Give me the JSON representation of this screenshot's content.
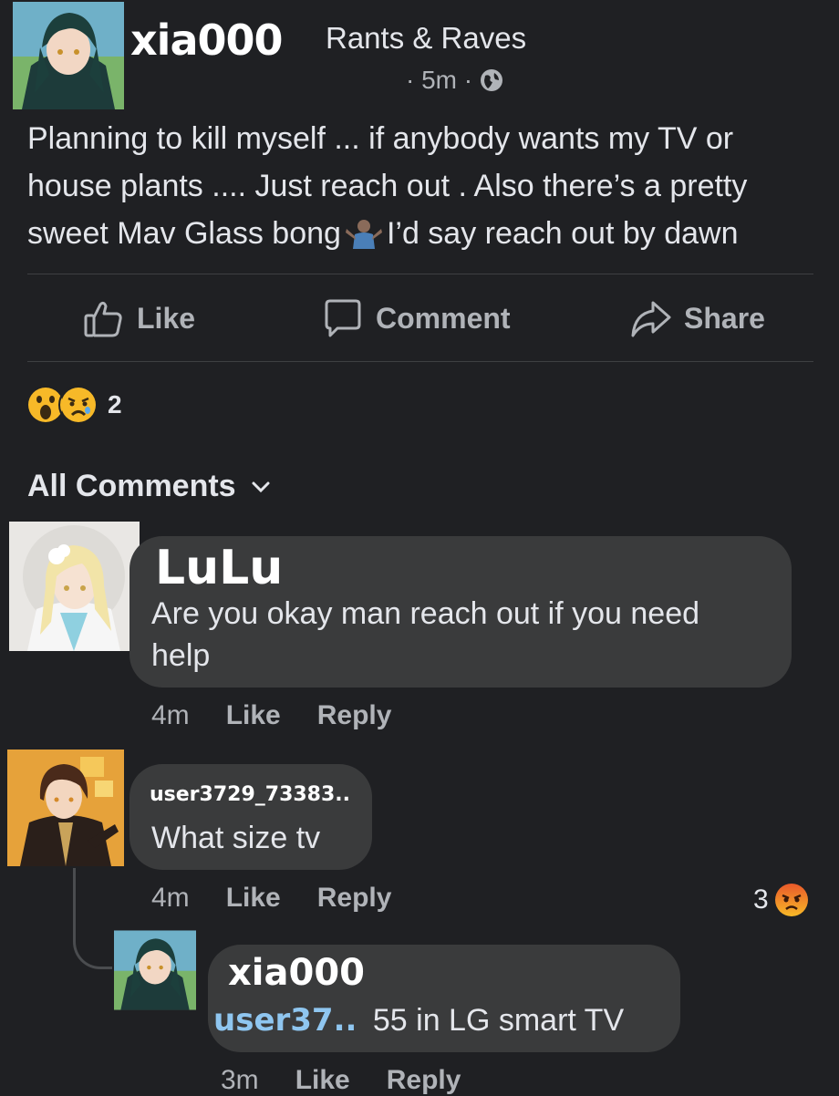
{
  "post": {
    "author": "xia000",
    "group": "Rants & Raves",
    "time": "· 5m ·",
    "text_line1": "Planning to kill myself ... if anybody wants my TV or",
    "text_line2": "house plants .... Just reach out . Also there’s a pretty",
    "text_line3a": "sweet Mav Glass bong",
    "text_line3b": "I’d say reach out by dawn",
    "privacy_icon": "globe-icon"
  },
  "actions": {
    "like": "Like",
    "comment": "Comment",
    "share": "Share"
  },
  "reactions": {
    "types": [
      "wow",
      "sad"
    ],
    "count": "2"
  },
  "comments_filter": "All Comments",
  "comments": [
    {
      "author": "LuLu",
      "text_line1": "Are you okay man reach out if you need",
      "text_line2": "help",
      "time": "4m",
      "like": "Like",
      "reply": "Reply"
    },
    {
      "author": "user3729_73383..",
      "text": "What size tv",
      "time": "4m",
      "like": "Like",
      "reply": "Reply",
      "reaction_count": "3",
      "reaction_type": "angry"
    }
  ],
  "reply": {
    "author": "xia000",
    "mention": "user37..",
    "text": "55 in LG smart TV",
    "time": "3m",
    "like": "Like",
    "reply": "Reply"
  },
  "colors": {
    "background": "#1f2023",
    "bubble": "#3a3b3c",
    "mention": "#8fc6f0",
    "muted": "#b0b3b8"
  }
}
